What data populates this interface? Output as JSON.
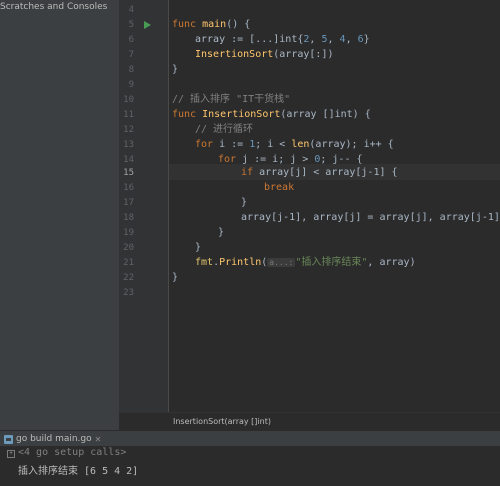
{
  "sidebar": {
    "item_label": "Scratches and Consoles"
  },
  "editor": {
    "line_numbers": [
      "4",
      "5",
      "6",
      "7",
      "8",
      "9",
      "10",
      "11",
      "12",
      "13",
      "14",
      "15",
      "16",
      "17",
      "18",
      "19",
      "20",
      "21",
      "22",
      "23"
    ],
    "active_line": "15",
    "lines": {
      "l5": {
        "kw": "func",
        "fn": "main",
        "rest": "() {"
      },
      "l6": {
        "a": "array := [...]int{",
        "n1": "2",
        "s1": ", ",
        "n2": "5",
        "s2": ", ",
        "n3": "4",
        "s3": ", ",
        "n4": "6",
        "b": "}"
      },
      "l7": {
        "fn": "InsertionSort",
        "rest": "(array[:])"
      },
      "l8": {
        "text": "}"
      },
      "l10": {
        "comment": "// 插入排序 \"IT干货栈\""
      },
      "l11": {
        "kw": "func",
        "fn": "InsertionSort",
        "rest": "(array []int) {"
      },
      "l12": {
        "comment": "// 进行循环"
      },
      "l13": {
        "kw": "for",
        "a": " i := ",
        "n1": "1",
        "b": "; i < ",
        "fn": "len",
        "c": "(array); i++ {"
      },
      "l14": {
        "kw": "for",
        "a": " j := i; j > ",
        "n1": "0",
        "b": "; j-- {"
      },
      "l15": {
        "kw": "if",
        "rest": " array[j] < array[j-1] {"
      },
      "l16": {
        "kw": "break"
      },
      "l17": {
        "text": "}"
      },
      "l18": {
        "text": "array[j-1], array[j] = array[j], array[j-1]"
      },
      "l19": {
        "text": "}"
      },
      "l20": {
        "text": "}"
      },
      "l21": {
        "pkg": "fmt",
        "a": ".",
        "fn": "Println",
        "b": "(",
        "hint": "a...:",
        "str": "\"插入排序结束\"",
        "c": ", array)"
      },
      "l22": {
        "text": "}"
      }
    }
  },
  "statusbar": {
    "breadcrumb": "InsertionSort(array []int)"
  },
  "run_panel": {
    "tab_label": "go build main.go",
    "console_lines": [
      "<4 go setup calls>",
      "插入排序结束 [6 5 4 2]"
    ]
  }
}
